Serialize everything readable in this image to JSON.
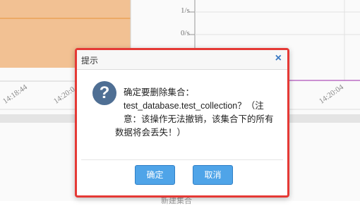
{
  "background": {
    "y_ticks": [
      "1/s",
      "0/s"
    ],
    "x_ticks_left": [
      "14:18:44",
      "14:20:0"
    ],
    "x_ticks_right": [
      "14:20:04"
    ],
    "footer_text": "新建集合"
  },
  "dialog": {
    "title": "提示",
    "close_label": "×",
    "icon_glyph": "?",
    "message_lines": [
      "确定要删除集合：",
      "test_database.test_collection？（注",
      "意：该操作无法撤销，该集合下的所有",
      "数据将会丢失！）"
    ],
    "confirm_label": "确定",
    "cancel_label": "取消"
  },
  "colors": {
    "highlight_border": "#e53935",
    "button": "#4fa4e8",
    "chart_fill": "#f7c596",
    "chart_line": "#c070c8"
  }
}
